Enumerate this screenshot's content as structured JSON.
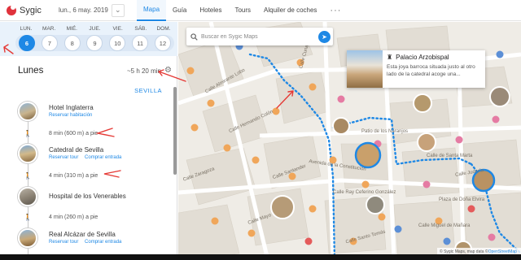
{
  "app": {
    "brand": "Sygic",
    "date_display": "lun., 6 may. 2019",
    "nav_tabs": [
      "Mapa",
      "Guía",
      "Hoteles",
      "Tours",
      "Alquiler de coches"
    ],
    "nav_active": "Mapa",
    "more_menu": "···"
  },
  "calendar": {
    "weekday_labels": [
      "LUN.",
      "MAR.",
      "MIÉ.",
      "JUE.",
      "VIE.",
      "SÁB.",
      "DOM."
    ],
    "days": [
      "6",
      "7",
      "8",
      "9",
      "10",
      "11",
      "12"
    ],
    "selected_day": "6"
  },
  "day_summary": {
    "day_name": "Lunes",
    "total_time": "~5 h 20 min",
    "city": "SEVILLA"
  },
  "itinerary": {
    "stops": [
      {
        "name": "Hotel Inglaterra",
        "links": [
          "Reservar habitación"
        ]
      },
      {
        "name": "Catedral de Sevilla",
        "links": [
          "Reservar tour",
          "Comprar entrada"
        ]
      },
      {
        "name": "Hospital de los Venerables",
        "links": []
      },
      {
        "name": "Real Alcázar de Sevilla",
        "links": [
          "Reservar tour",
          "Comprar entrada"
        ]
      }
    ],
    "legs": [
      "8 min (600 m) a pie",
      "4 min (310 m) a pie",
      "4 min (260 m) a pie"
    ]
  },
  "map": {
    "search_placeholder": "Buscar en Sygic Maps",
    "popup": {
      "title": "Palacio Arzobispal",
      "description": "Esta joya barroca situada justo al otro lado de la catedral acoge una..."
    },
    "road_labels": [
      "Calle Almirante Lobo",
      "Calle Zaragoza",
      "Calle Hernando Colón",
      "Calle Santander",
      "Avenida de la Constitución",
      "Calle Ray Ceferino González",
      "Calle Santo Tomás",
      "Patio de los Naranjos",
      "Calle de Santa Marta",
      "Plaza de Doña Elvira",
      "Calle Judería",
      "Calle Miguel de Mañara",
      "Calle Cuna",
      "Calle Mayo"
    ],
    "attribution_prefix": "© Sygic Maps, map data © ",
    "attribution_link": "OpenStreetMap"
  },
  "colors": {
    "accent": "#1e88e5",
    "route_dots": "#1e88e5",
    "annotation_red": "#e53935",
    "poi_orange": "#f0a65a",
    "poi_pink": "#e57ba3",
    "poi_blue": "#5c8fd6"
  },
  "icons": {
    "logo": "sygic-logo",
    "date_menu": "chevron-down-icon",
    "settings": "gear-icon",
    "walk": "walking-person-icon",
    "search": "search-icon",
    "directions": "directions-icon",
    "landmark": "landmark-icon"
  }
}
